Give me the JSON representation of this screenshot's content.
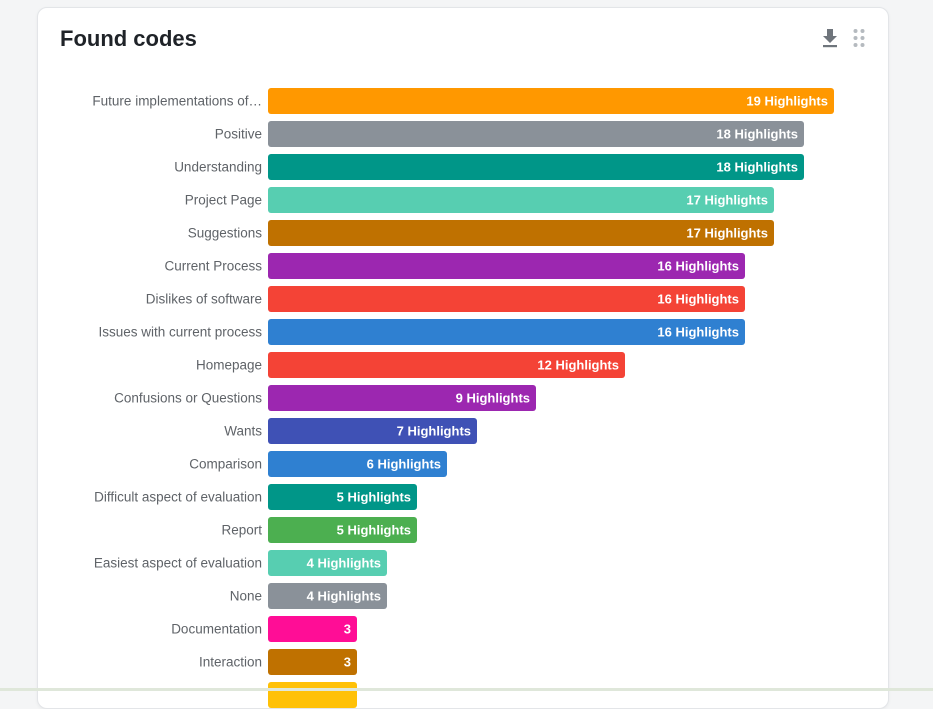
{
  "card": {
    "title": "Found codes"
  },
  "icons": {
    "download": "download-icon",
    "drag": "drag-handle-icon"
  },
  "chart_data": {
    "type": "bar",
    "orientation": "horizontal",
    "title": "Found codes",
    "xlabel": "",
    "ylabel": "",
    "grid": false,
    "xlim": [
      0,
      19
    ],
    "categories": [
      "Future implementations of…",
      "Positive",
      "Understanding",
      "Project Page",
      "Suggestions",
      "Current Process",
      "Dislikes of software",
      "Issues with current process",
      "Homepage",
      "Confusions or Questions",
      "Wants",
      "Comparison",
      "Difficult aspect of evaluation",
      "Report",
      "Easiest aspect of evaluation",
      "None",
      "Documentation",
      "Interaction",
      ""
    ],
    "values": [
      19,
      18,
      18,
      17,
      17,
      16,
      16,
      16,
      12,
      9,
      7,
      6,
      5,
      5,
      4,
      4,
      3,
      3,
      3
    ],
    "data_labels": [
      "19 Highlights",
      "18 Highlights",
      "18 Highlights",
      "17 Highlights",
      "17 Highlights",
      "16 Highlights",
      "16 Highlights",
      "16 Highlights",
      "12 Highlights",
      "9 Highlights",
      "7 Highlights",
      "6 Highlights",
      "5 Highlights",
      "5 Highlights",
      "4 Highlights",
      "4 Highlights",
      "3",
      "3",
      ""
    ],
    "colors": [
      "#ff9800",
      "#8a9199",
      "#009688",
      "#57ceb1",
      "#bf7100",
      "#9c27b0",
      "#f44336",
      "#2f80d1",
      "#f44336",
      "#9c27b0",
      "#3f51b5",
      "#2f80d1",
      "#009688",
      "#4caf50",
      "#57ceb1",
      "#8a9199",
      "#ff0d96",
      "#bf7100",
      "#ffc107"
    ],
    "label_color": "#ffffff",
    "category_text_color": "#5f6368"
  }
}
